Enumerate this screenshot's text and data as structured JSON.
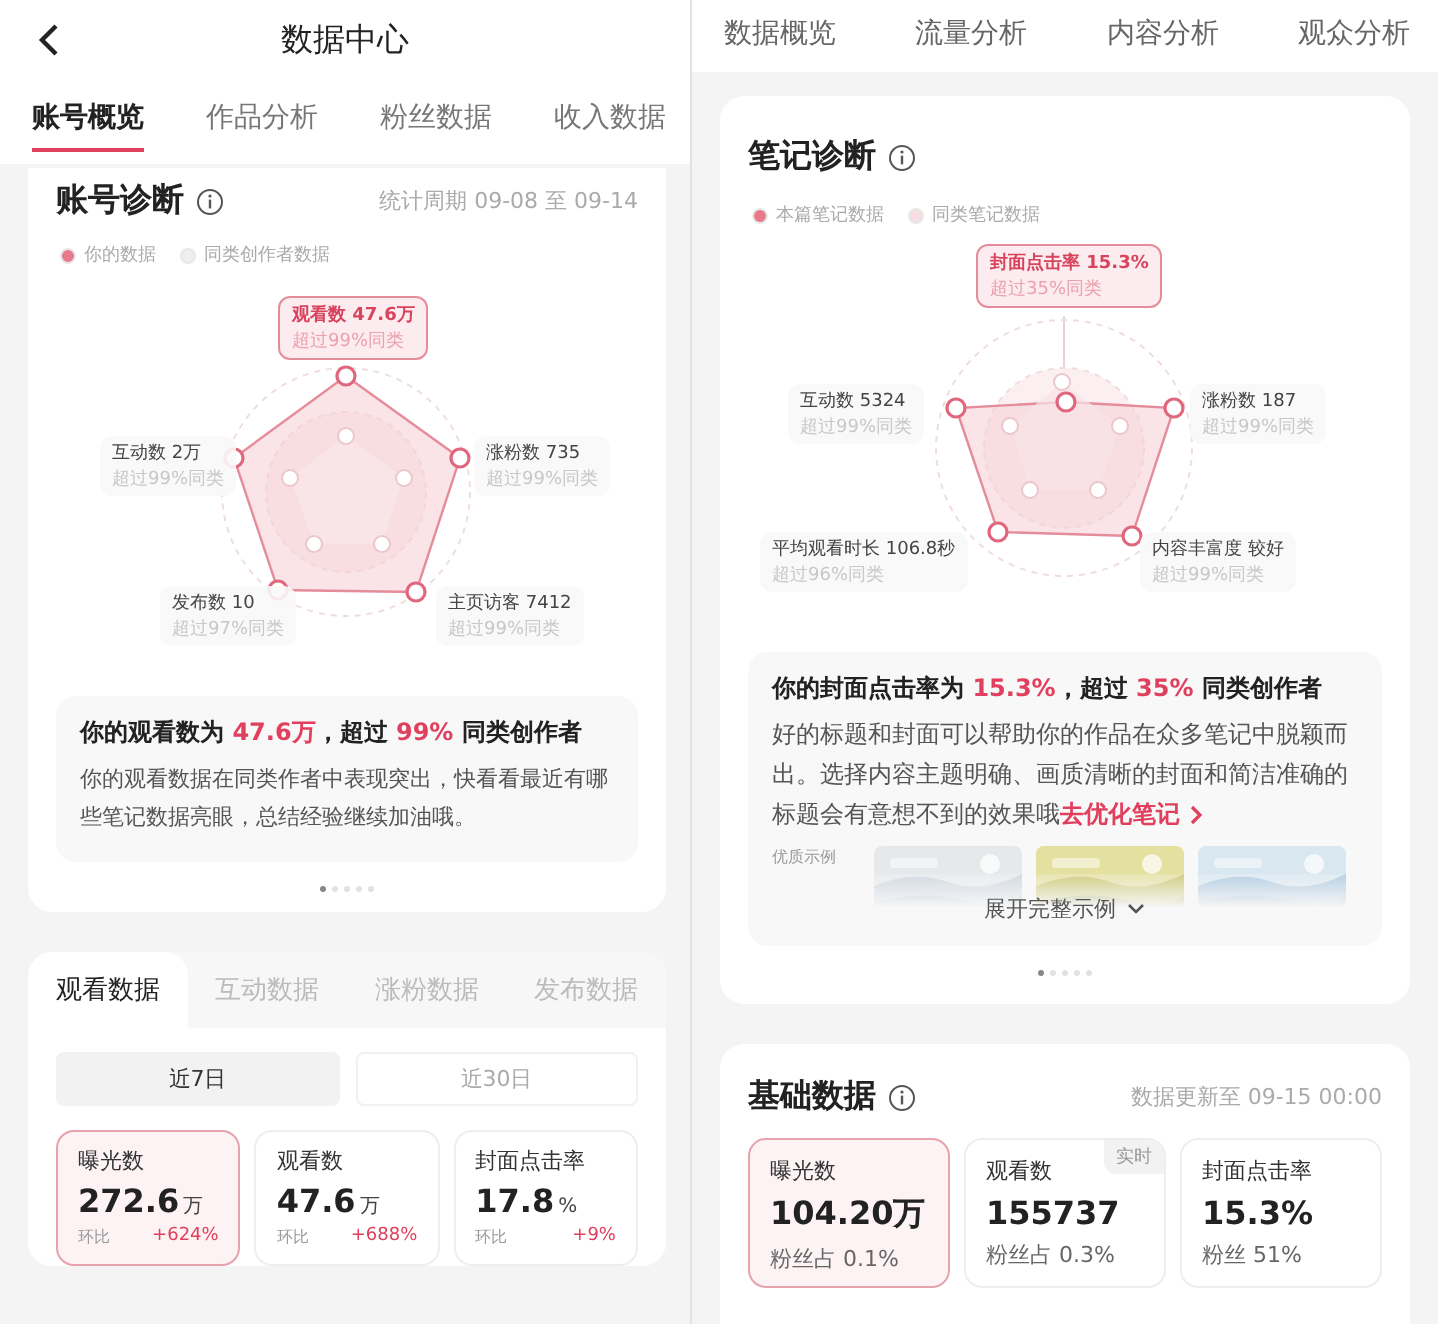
{
  "left": {
    "header": {
      "title": "数据中心"
    },
    "tabs": [
      {
        "label": "账号概览",
        "selected": true
      },
      {
        "label": "作品分析",
        "selected": false
      },
      {
        "label": "粉丝数据",
        "selected": false
      },
      {
        "label": "收入数据",
        "selected": false
      }
    ],
    "diagnosis": {
      "title": "账号诊断",
      "period": "统计周期 09-08 至 09-14",
      "legend": [
        {
          "label": "你的数据",
          "color": "#e8798b"
        },
        {
          "label": "同类创作者数据",
          "color": "#eeeeee"
        }
      ],
      "radar": [
        {
          "name": "观看数 47.6万",
          "note": "超过99%同类",
          "selected": true
        },
        {
          "name": "互动数 2万",
          "note": "超过99%同类",
          "selected": false
        },
        {
          "name": "涨粉数 735",
          "note": "超过99%同类",
          "selected": false
        },
        {
          "name": "发布数 10",
          "note": "超过97%同类",
          "selected": false
        },
        {
          "name": "主页访客 7412",
          "note": "超过99%同类",
          "selected": false
        }
      ],
      "summary": {
        "heading": "你的观看数为 **47.6万**，超过 **99%** 同类创作者",
        "body": "你的观看数据在同类作者中表现突出，快看看最近有哪些笔记数据亮眼，总结经验继续加油哦。"
      },
      "pages": [
        {
          "selected": true
        },
        {
          "selected": false
        },
        {
          "selected": false
        },
        {
          "selected": false
        },
        {
          "selected": false
        }
      ]
    },
    "views": {
      "tabs": [
        {
          "label": "观看数据",
          "selected": true
        },
        {
          "label": "互动数据",
          "selected": false
        },
        {
          "label": "涨粉数据",
          "selected": false
        },
        {
          "label": "发布数据",
          "selected": false
        }
      ],
      "ranges": [
        {
          "label": "近7日",
          "selected": true
        },
        {
          "label": "近30日",
          "selected": false
        }
      ],
      "metrics": [
        {
          "label": "曝光数",
          "value": "272.6",
          "unit": "万",
          "compare": "环比",
          "change": "+624%",
          "selected": true
        },
        {
          "label": "观看数",
          "value": "47.6",
          "unit": "万",
          "compare": "环比",
          "change": "+688%",
          "selected": false
        },
        {
          "label": "封面点击率",
          "value": "17.8",
          "unit": "%",
          "compare": "环比",
          "change": "+9%",
          "selected": false
        }
      ]
    }
  },
  "right": {
    "tabs": [
      {
        "label": "数据概览"
      },
      {
        "label": "流量分析"
      },
      {
        "label": "内容分析"
      },
      {
        "label": "观众分析"
      }
    ],
    "diagnosis": {
      "title": "笔记诊断",
      "legend": [
        {
          "label": "本篇笔记数据",
          "color": "#e8798b"
        },
        {
          "label": "同类笔记数据",
          "color": "#f6dde2"
        }
      ],
      "radar": [
        {
          "name": "封面点击率 15.3%",
          "note": "超过35%同类",
          "selected": true
        },
        {
          "name": "互动数 5324",
          "note": "超过99%同类",
          "selected": false
        },
        {
          "name": "涨粉数 187",
          "note": "超过99%同类",
          "selected": false
        },
        {
          "name": "平均观看时长 106.8秒",
          "note": "超过96%同类",
          "selected": false
        },
        {
          "name": "内容丰富度 较好",
          "note": "超过99%同类",
          "selected": false
        }
      ],
      "summary": {
        "heading": "你的封面点击率为 **15.3%**，超过 **35%** 同类创作者",
        "body": "好的标题和封面可以帮助你的作品在众多笔记中脱颖而出。选择内容主题明确、画质清晰的封面和简洁准确的标题会有意想不到的效果哦",
        "link": "去优化笔记",
        "examples": {
          "label": "优质示例",
          "expand": "展开完整示例"
        }
      },
      "pages": [
        {
          "selected": true
        },
        {
          "selected": false
        },
        {
          "selected": false
        },
        {
          "selected": false
        },
        {
          "selected": false
        }
      ]
    },
    "basics": {
      "title": "基础数据",
      "updated": "数据更新至 09-15 00:00",
      "metrics": [
        {
          "label": "曝光数",
          "value": "104.20万",
          "sub": "粉丝占 0.1%",
          "selected": true
        },
        {
          "label": "观看数",
          "value": "155737",
          "sub": "粉丝占 0.3%",
          "badge": "实时",
          "selected": false
        },
        {
          "label": "封面点击率",
          "value": "15.3%",
          "sub": "粉丝 51%",
          "selected": false
        }
      ]
    }
  }
}
